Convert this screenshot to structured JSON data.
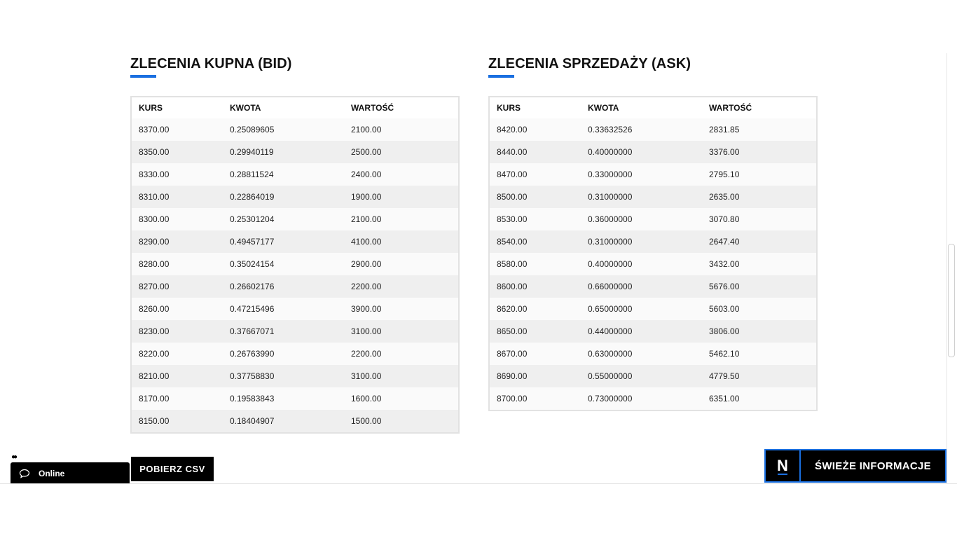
{
  "bid": {
    "title": "ZLECENIA KUPNA (BID)",
    "headers": [
      "KURS",
      "KWOTA",
      "WARTOŚĆ"
    ],
    "rows": [
      [
        "8370.00",
        "0.25089605",
        "2100.00"
      ],
      [
        "8350.00",
        "0.29940119",
        "2500.00"
      ],
      [
        "8330.00",
        "0.28811524",
        "2400.00"
      ],
      [
        "8310.00",
        "0.22864019",
        "1900.00"
      ],
      [
        "8300.00",
        "0.25301204",
        "2100.00"
      ],
      [
        "8290.00",
        "0.49457177",
        "4100.00"
      ],
      [
        "8280.00",
        "0.35024154",
        "2900.00"
      ],
      [
        "8270.00",
        "0.26602176",
        "2200.00"
      ],
      [
        "8260.00",
        "0.47215496",
        "3900.00"
      ],
      [
        "8230.00",
        "0.37667071",
        "3100.00"
      ],
      [
        "8220.00",
        "0.26763990",
        "2200.00"
      ],
      [
        "8210.00",
        "0.37758830",
        "3100.00"
      ],
      [
        "8170.00",
        "0.19583843",
        "1600.00"
      ],
      [
        "8150.00",
        "0.18404907",
        "1500.00"
      ]
    ]
  },
  "ask": {
    "title": "ZLECENIA SPRZEDAŻY (ASK)",
    "headers": [
      "KURS",
      "KWOTA",
      "WARTOŚĆ"
    ],
    "rows": [
      [
        "8420.00",
        "0.33632526",
        "2831.85"
      ],
      [
        "8440.00",
        "0.40000000",
        "3376.00"
      ],
      [
        "8470.00",
        "0.33000000",
        "2795.10"
      ],
      [
        "8500.00",
        "0.31000000",
        "2635.00"
      ],
      [
        "8530.00",
        "0.36000000",
        "3070.80"
      ],
      [
        "8540.00",
        "0.31000000",
        "2647.40"
      ],
      [
        "8580.00",
        "0.40000000",
        "3432.00"
      ],
      [
        "8600.00",
        "0.66000000",
        "5676.00"
      ],
      [
        "8620.00",
        "0.65000000",
        "5603.00"
      ],
      [
        "8650.00",
        "0.44000000",
        "3806.00"
      ],
      [
        "8670.00",
        "0.63000000",
        "5462.10"
      ],
      [
        "8690.00",
        "0.55000000",
        "4779.50"
      ],
      [
        "8700.00",
        "0.73000000",
        "6351.00"
      ]
    ]
  },
  "csv_button": {
    "label": "POBIERZ CSV"
  },
  "chat": {
    "status": "Online",
    "icon": "chat-bubble-icon"
  },
  "news": {
    "logo": "N",
    "label": "ŚWIEŻE INFORMACJE"
  },
  "colors": {
    "accent": "#1a6fe0",
    "dark": "#000000"
  }
}
